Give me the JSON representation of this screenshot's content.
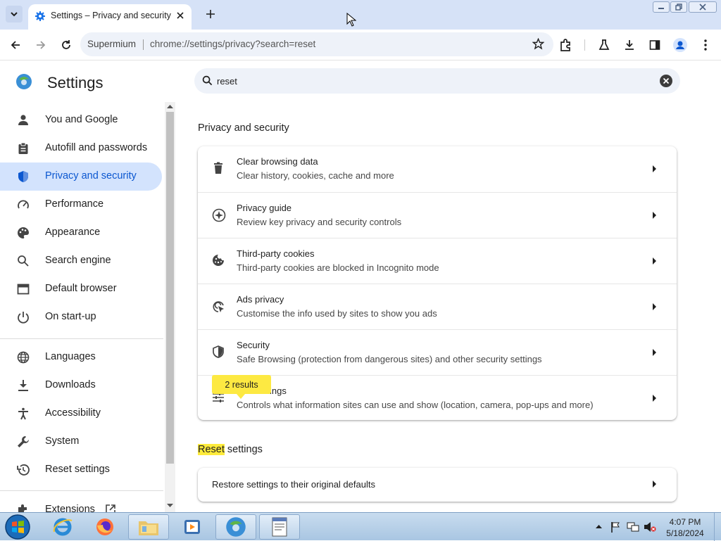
{
  "browser": {
    "tab_title": "Settings – Privacy and security",
    "site_chip": "Supermium",
    "url": "chrome://settings/privacy?search=reset"
  },
  "sidebar": {
    "title": "Settings",
    "items": [
      {
        "label": "You and Google",
        "icon": "person-icon",
        "active": false
      },
      {
        "label": "Autofill and passwords",
        "icon": "clipboard-icon",
        "active": false
      },
      {
        "label": "Privacy and security",
        "icon": "shield-icon",
        "active": true
      },
      {
        "label": "Performance",
        "icon": "speedometer-icon",
        "active": false
      },
      {
        "label": "Appearance",
        "icon": "palette-icon",
        "active": false
      },
      {
        "label": "Search engine",
        "icon": "search-icon",
        "active": false
      },
      {
        "label": "Default browser",
        "icon": "browser-window-icon",
        "active": false
      },
      {
        "label": "On start-up",
        "icon": "power-icon",
        "active": false
      },
      {
        "label": "Languages",
        "icon": "globe-icon",
        "active": false
      },
      {
        "label": "Downloads",
        "icon": "download-icon",
        "active": false
      },
      {
        "label": "Accessibility",
        "icon": "accessibility-icon",
        "active": false
      },
      {
        "label": "System",
        "icon": "wrench-icon",
        "active": false
      },
      {
        "label": "Reset settings",
        "icon": "history-icon",
        "active": false
      },
      {
        "label": "Extensions",
        "icon": "puzzle-icon",
        "active": false
      }
    ]
  },
  "search": {
    "value": "reset"
  },
  "main": {
    "section1_title": "Privacy and security",
    "rows": [
      {
        "title": "Clear browsing data",
        "subtitle": "Clear history, cookies, cache and more",
        "icon": "trash-icon"
      },
      {
        "title": "Privacy guide",
        "subtitle": "Review key privacy and security controls",
        "icon": "compass-icon"
      },
      {
        "title": "Third-party cookies",
        "subtitle": "Third-party cookies are blocked in Incognito mode",
        "icon": "cookie-icon"
      },
      {
        "title": "Ads privacy",
        "subtitle": "Customise the info used by sites to show you ads",
        "icon": "ads-privacy-icon"
      },
      {
        "title": "Security",
        "subtitle": "Safe Browsing (protection from dangerous sites) and other security settings",
        "icon": "security-shield-icon"
      },
      {
        "title": "Site settings",
        "subtitle": "Controls what information sites can use and show (location, camera, pop-ups and more)",
        "icon": "sliders-icon"
      }
    ],
    "results_bubble": "2 results",
    "section2_highlight": "Reset",
    "section2_rest": " settings",
    "restore_label": "Restore settings to their original defaults"
  },
  "taskbar": {
    "time": "4:07 PM",
    "date": "5/18/2024"
  },
  "colors": {
    "accent": "#0b57d0",
    "active_nav_bg": "#d3e3fd",
    "search_highlight": "#ffeb3b"
  }
}
